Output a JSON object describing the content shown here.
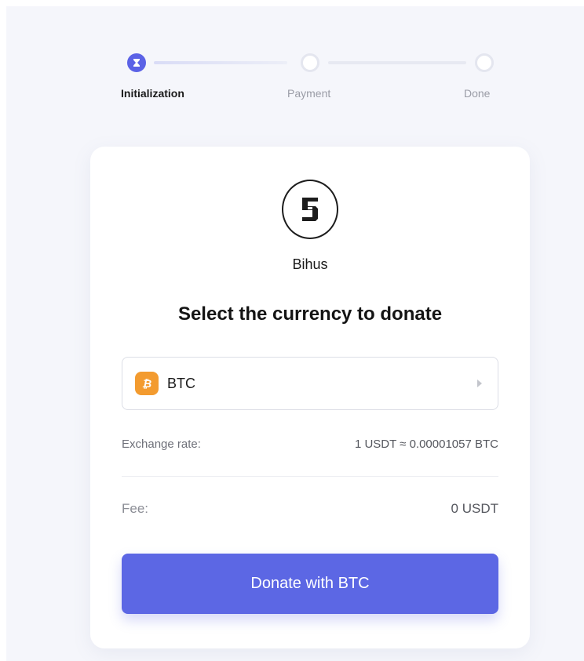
{
  "stepper": {
    "steps": [
      {
        "label": "Initialization",
        "state": "active"
      },
      {
        "label": "Payment",
        "state": "pending"
      },
      {
        "label": "Done",
        "state": "pending"
      }
    ],
    "active_color": "#5b62e6"
  },
  "card": {
    "org_logo": "bihus-logo-icon",
    "org_name": "Bihus",
    "title": "Select the currency to donate",
    "currency_select": {
      "selected": "BTC",
      "icon": "bitcoin-icon",
      "icon_color": "#f39b2f"
    },
    "exchange_rate": {
      "label": "Exchange rate:",
      "value": "1 USDT ≈ 0.00001057 BTC"
    },
    "fee": {
      "label": "Fee:",
      "value": "0 USDT"
    },
    "donate_button": {
      "label": "Donate with BTC",
      "color": "#5c67e4"
    }
  }
}
